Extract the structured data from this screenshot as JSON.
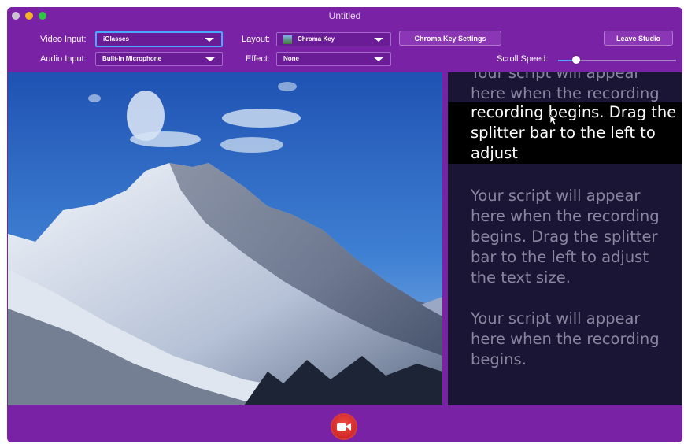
{
  "window": {
    "title": "Untitled"
  },
  "toolbar": {
    "video_input_label": "Video Input:",
    "video_input_value": "iGlasses",
    "audio_input_label": "Audio Input:",
    "audio_input_value": "Built-in Microphone",
    "layout_label": "Layout:",
    "layout_value": "Chroma Key",
    "effect_label": "Effect:",
    "effect_value": "None",
    "chroma_key_settings_label": "Chroma Key Settings",
    "leave_studio_label": "Leave Studio",
    "scroll_speed_label": "Scroll Speed:",
    "scroll_speed_level": 0.15
  },
  "script": {
    "blocks": [
      "Your script will appear here when the recording begins. Drag the splitter bar to the left to adjust the text size.",
      "Your script will appear here when the recording begins. Drag the splitter bar to the left to adjust the text size.",
      "Your script will appear here when the recording begins."
    ],
    "highlight": "recording begins. Drag the splitter bar to the left to adjust"
  },
  "colors": {
    "accent": "#7a22a6",
    "focus": "#4aa8ff",
    "record": "#e0322c",
    "script_bg": "#1a1535"
  },
  "icons": {
    "record": "video-camera-icon"
  }
}
